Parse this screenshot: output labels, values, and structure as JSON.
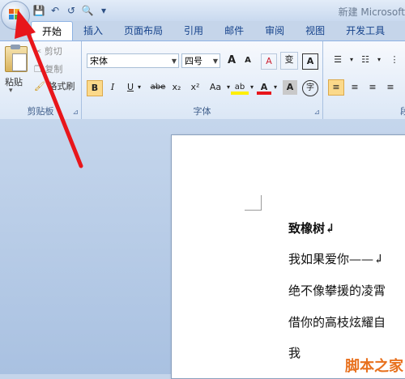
{
  "titlebar": {
    "window_title": "新建 Microsoft"
  },
  "qat": {
    "save": "💾",
    "undo": "↶",
    "redo": "↺",
    "preview": "🔍",
    "customize": "▾"
  },
  "tabs": [
    {
      "label": "开始"
    },
    {
      "label": "插入"
    },
    {
      "label": "页面布局"
    },
    {
      "label": "引用"
    },
    {
      "label": "邮件"
    },
    {
      "label": "审阅"
    },
    {
      "label": "视图"
    },
    {
      "label": "开发工具"
    }
  ],
  "clipboard": {
    "paste_label": "粘贴",
    "cut_label": "剪切",
    "copy_label": "复制",
    "format_painter_label": "格式刷",
    "group_label": "剪贴板"
  },
  "font": {
    "font_name": "宋体",
    "font_size": "四号",
    "grow": "A",
    "shrink": "A",
    "clear": "A",
    "phonetic": "变",
    "border": "A",
    "bold": "B",
    "italic": "I",
    "underline": "U",
    "strike": "abe",
    "subscript": "x₂",
    "superscript": "x²",
    "case": "Aa",
    "highlight": "ab",
    "color": "A",
    "shade": "A",
    "enclose": "字",
    "group_label": "字体"
  },
  "paragraph": {
    "group_label": "段"
  },
  "document": {
    "lines": [
      "致橡树↲",
      "我如果爱你——↲",
      "绝不像攀援的凌霄",
      "借你的高枝炫耀自",
      "我"
    ]
  },
  "watermark": {
    "site": "jb51.net",
    "name": "脚本之家"
  },
  "colors": {
    "accent_tab": "#15428b",
    "arrow": "#e8161b",
    "page_bg": "#ffffff"
  }
}
